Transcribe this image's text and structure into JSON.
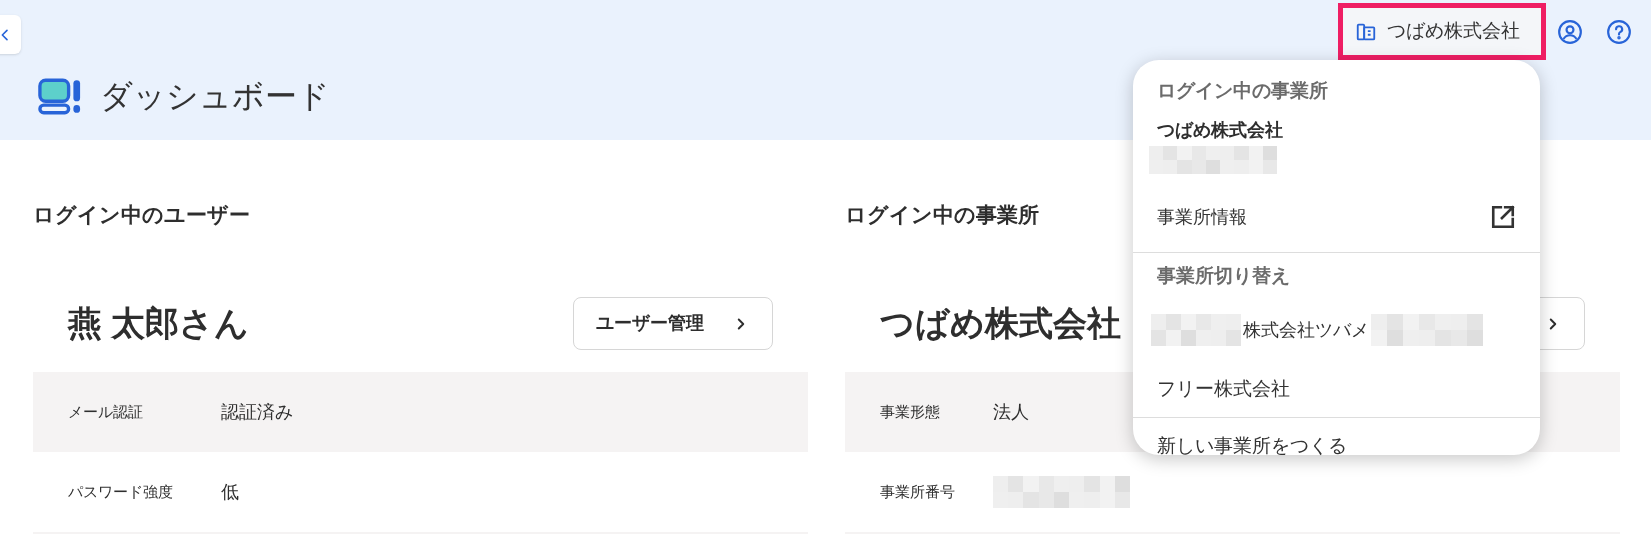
{
  "header": {
    "title": "ダッシュボード",
    "company_button": {
      "label": "つばめ株式会社",
      "highlighted": true
    }
  },
  "user_panel": {
    "heading": "ログイン中のユーザー",
    "name": "燕 太郎さん",
    "button": "ユーザー管理",
    "rows": [
      {
        "label": "メール認証",
        "kind": "text",
        "value": "認証済み"
      },
      {
        "label": "パスワード強度",
        "kind": "text",
        "value": "低"
      }
    ]
  },
  "office_panel": {
    "heading": "ログイン中の事業所",
    "name": "つばめ株式会社",
    "rows": [
      {
        "label": "事業形態",
        "kind": "text",
        "value": "法人"
      },
      {
        "label": "事業所番号",
        "kind": "redacted"
      }
    ]
  },
  "dropdown": {
    "sections": [
      {
        "items": [
          {
            "kind": "header",
            "text": "ログイン中の事業所"
          },
          {
            "kind": "current",
            "text": "つばめ株式会社"
          },
          {
            "kind": "redacted"
          },
          {
            "kind": "external_link",
            "text": "事業所情報"
          }
        ]
      },
      {
        "items": [
          {
            "kind": "header",
            "text": "事業所切り替え"
          },
          {
            "kind": "redacted_wrap",
            "text": "株式会社ツバメ"
          },
          {
            "kind": "option",
            "text": "フリー株式会社"
          }
        ]
      },
      {
        "items": [
          {
            "kind": "option",
            "text": "新しい事業所をつくる"
          }
        ]
      }
    ]
  }
}
